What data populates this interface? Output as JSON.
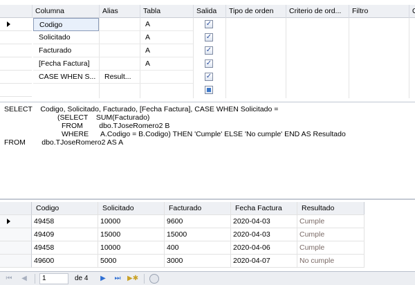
{
  "criteria": {
    "headers": [
      "Columna",
      "Alias",
      "Tabla",
      "Salida",
      "Tipo de orden",
      "Criterio de ord...",
      "Filtro",
      "O"
    ],
    "rows": [
      {
        "column": "Codigo",
        "alias": "",
        "table": "A",
        "output": true
      },
      {
        "column": "Solicitado",
        "alias": "",
        "table": "A",
        "output": true
      },
      {
        "column": "Facturado",
        "alias": "",
        "table": "A",
        "output": true
      },
      {
        "column": "[Fecha Factura]",
        "alias": "",
        "table": "A",
        "output": true
      },
      {
        "column": "CASE WHEN S...",
        "alias": "Result...",
        "table": "",
        "output": true
      }
    ],
    "checkmark": "✓"
  },
  "sql": {
    "lines": [
      "SELECT    Codigo, Solicitado, Facturado, [Fecha Factura], CASE WHEN Solicitado =",
      "(SELECT    SUM(Facturado)",
      "FROM        dbo.TJoseRomero2 B",
      "WHERE      A.Codigo = B.Codigo) THEN 'Cumple' ELSE 'No cumple' END AS Resultado",
      "FROM        dbo.TJoseRomero2 AS A"
    ]
  },
  "results": {
    "headers": [
      "Codigo",
      "Solicitado",
      "Facturado",
      "Fecha Factura",
      "Resultado"
    ],
    "rows": [
      [
        "49458",
        "10000",
        "9600",
        "2020-04-03",
        "Cumple"
      ],
      [
        "49409",
        "15000",
        "15000",
        "2020-04-03",
        "Cumple"
      ],
      [
        "49458",
        "10000",
        "400",
        "2020-04-06",
        "Cumple"
      ],
      [
        "49600",
        "5000",
        "3000",
        "2020-04-07",
        "No cumple"
      ]
    ]
  },
  "navigator": {
    "current_page": "1",
    "page_count_text": "de 4",
    "first_icon": "first-record-icon",
    "prev_icon": "previous-record-icon",
    "next_icon": "next-record-icon",
    "last_icon": "last-record-icon",
    "new_icon": "new-record-icon",
    "stop_icon": "stop-icon"
  },
  "colors": {
    "header_bg": "#eef0f4",
    "selected_cell_bg": "#e8f0fb",
    "result_text": "#7a6a66",
    "nav_accent": "#2f6fd3"
  }
}
